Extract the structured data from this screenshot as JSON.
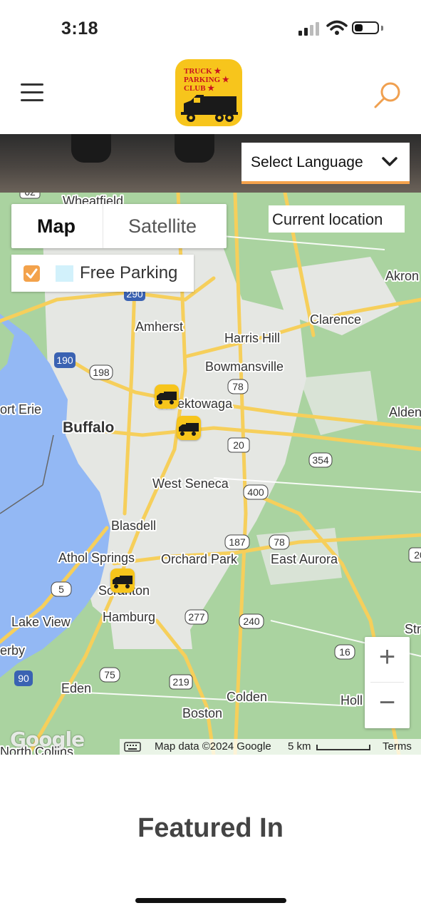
{
  "status_bar": {
    "time": "3:18"
  },
  "header": {
    "logo_lines": [
      "TRUCK",
      "PARKING",
      "CLUB"
    ]
  },
  "language": {
    "label": "Select Language"
  },
  "map": {
    "type_control": {
      "map": "Map",
      "satellite": "Satellite",
      "selected": "Map"
    },
    "free_parking": {
      "label": "Free Parking",
      "checked": true,
      "swatch_color": "#d2f1fb"
    },
    "current_location": "Current location",
    "labels": {
      "wheatfield": "Wheatfield",
      "akron": "Akron",
      "amherst": "Amherst",
      "clarence": "Clarence",
      "harris_hill": "Harris Hill",
      "bowmansville": "Bowmansville",
      "cheektowaga": "Cheektowaga",
      "fort_erie": "ort Erie",
      "alden": "Alden",
      "buffalo": "Buffalo",
      "west_seneca": "West Seneca",
      "blasdell": "Blasdell",
      "athol_springs": "Athol Springs",
      "orchard_park": "Orchard Park",
      "east_aurora": "East Aurora",
      "scranton": "Scranton",
      "hamburg": "Hamburg",
      "lake_view": "Lake View",
      "derby": "erby",
      "eden": "Eden",
      "colden": "Colden",
      "boston": "Boston",
      "holland": "Holl",
      "north_collins": "North Collins",
      "springville": "Str"
    },
    "road_shields": [
      "62",
      "290",
      "190",
      "198",
      "78",
      "20",
      "354",
      "400",
      "187",
      "78",
      "5",
      "277",
      "240",
      "16",
      "75",
      "219",
      "90",
      "20"
    ],
    "zoom_in": "+",
    "zoom_out": "−",
    "google_logo": "Google",
    "attribution": {
      "map_data": "Map data ©2024 Google",
      "scale": "5 km",
      "terms": "Terms"
    },
    "colors": {
      "land": "#aad3a0",
      "urban": "#e5e7e3",
      "water": "#93b8f4",
      "major_road": "#f6cf5b",
      "accent": "#f3a24b"
    }
  },
  "featured": {
    "title": "Featured In"
  }
}
